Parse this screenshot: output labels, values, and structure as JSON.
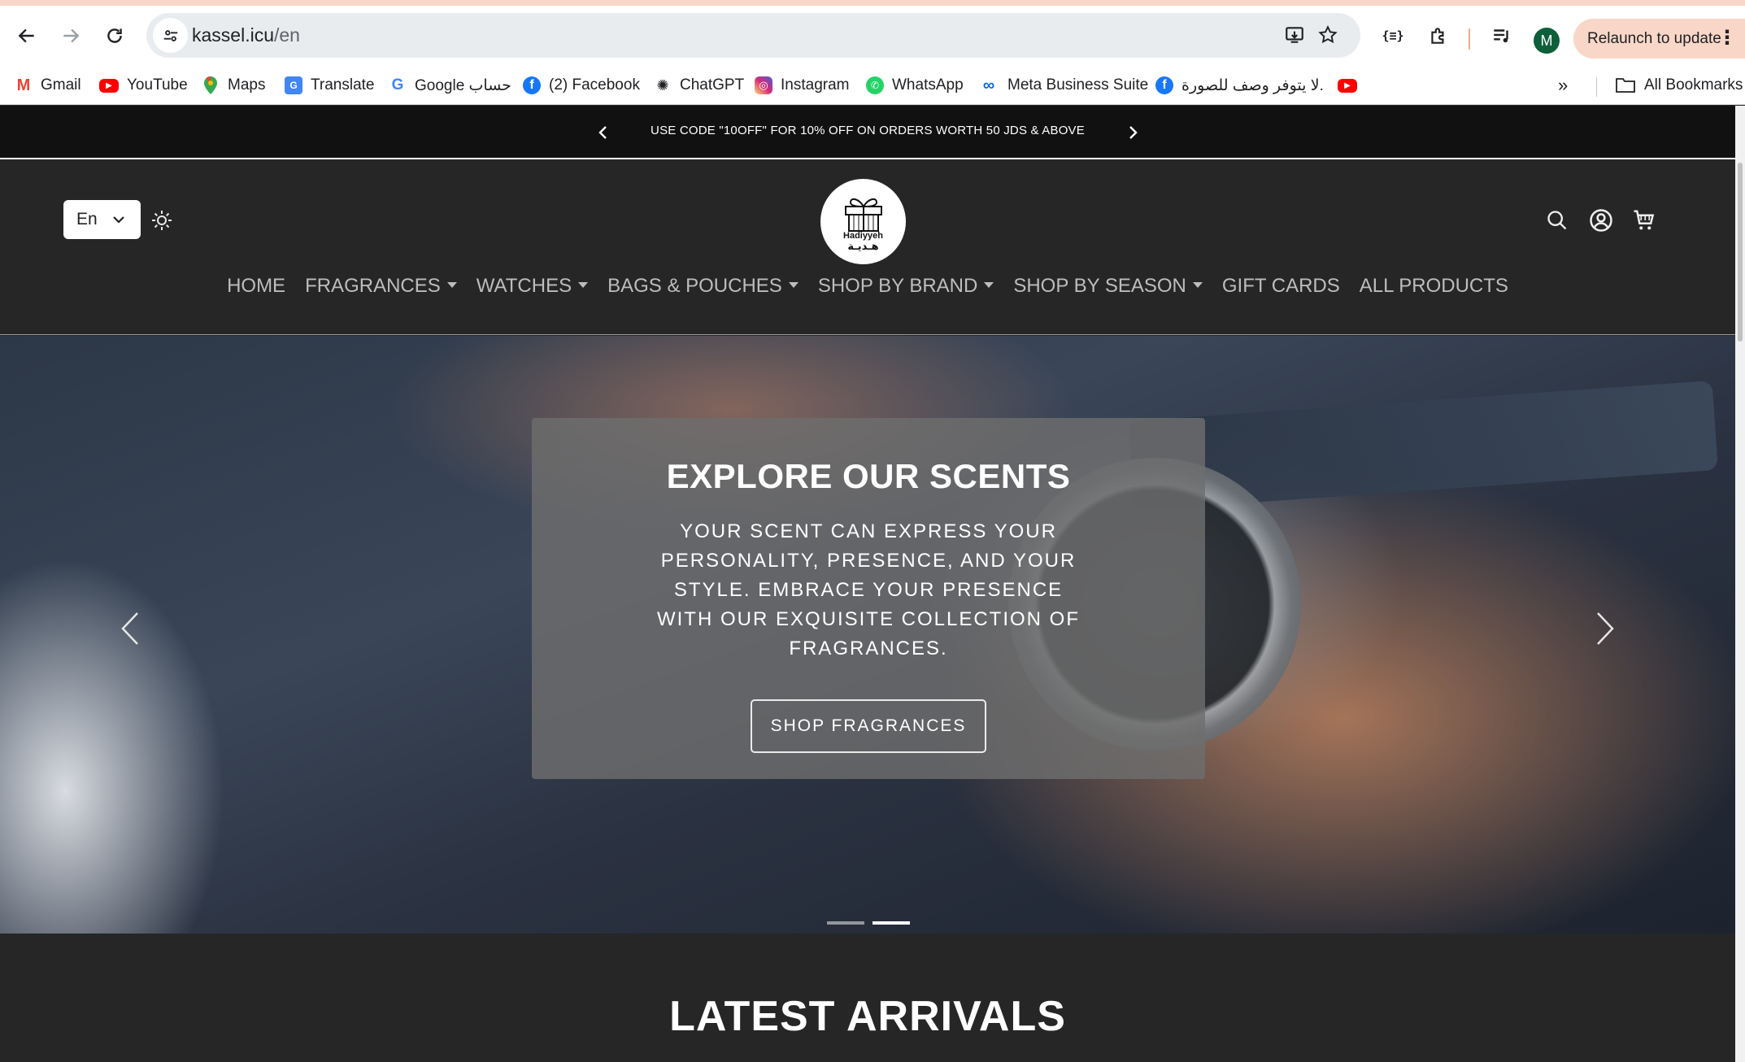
{
  "browser": {
    "url_host": "kassel.icu",
    "url_path": "/en",
    "profile_initial": "M",
    "relaunch_label": "Relaunch to update",
    "accent_color": "#f9d7c8"
  },
  "bookmarks": {
    "items": [
      {
        "label": "Gmail",
        "icon": "gmail-icon"
      },
      {
        "label": "YouTube",
        "icon": "youtube-icon"
      },
      {
        "label": "Maps",
        "icon": "maps-icon"
      },
      {
        "label": "Translate",
        "icon": "translate-icon"
      },
      {
        "label": "Google حساب",
        "icon": "google-icon"
      },
      {
        "label": "(2) Facebook",
        "icon": "facebook-icon"
      },
      {
        "label": "ChatGPT",
        "icon": "chatgpt-icon"
      },
      {
        "label": "Instagram",
        "icon": "instagram-icon"
      },
      {
        "label": "WhatsApp",
        "icon": "whatsapp-icon"
      },
      {
        "label": "Meta Business Suite",
        "icon": "meta-icon"
      },
      {
        "label": "لا يتوفر وصف للصورة.",
        "icon": "facebook-icon"
      }
    ],
    "all_bookmarks_label": "All Bookmarks"
  },
  "announcement": {
    "text": "USE CODE \"10OFF\" FOR 10% OFF ON ORDERS WORTH 50 JDS & ABOVE"
  },
  "header": {
    "language": "En",
    "logo_name": "Hadiyyeh",
    "logo_arabic": "هـديـة",
    "nav": [
      {
        "label": "HOME",
        "dropdown": false
      },
      {
        "label": "FRAGRANCES",
        "dropdown": true
      },
      {
        "label": "WATCHES",
        "dropdown": true
      },
      {
        "label": "BAGS & POUCHES",
        "dropdown": true
      },
      {
        "label": "SHOP BY BRAND",
        "dropdown": true
      },
      {
        "label": "SHOP BY SEASON",
        "dropdown": true
      },
      {
        "label": "GIFT CARDS",
        "dropdown": false
      },
      {
        "label": "ALL PRODUCTS",
        "dropdown": false
      }
    ]
  },
  "hero": {
    "title": "EXPLORE OUR SCENTS",
    "body": "YOUR SCENT CAN EXPRESS YOUR PERSONALITY, PRESENCE, AND YOUR STYLE. EMBRACE YOUR PRESENCE WITH OUR EXQUISITE COLLECTION OF FRAGRANCES.",
    "button_label": "SHOP FRAGRANCES",
    "slide_count": 2,
    "active_slide": 2
  },
  "sections": {
    "latest_title": "LATEST ARRIVALS"
  }
}
